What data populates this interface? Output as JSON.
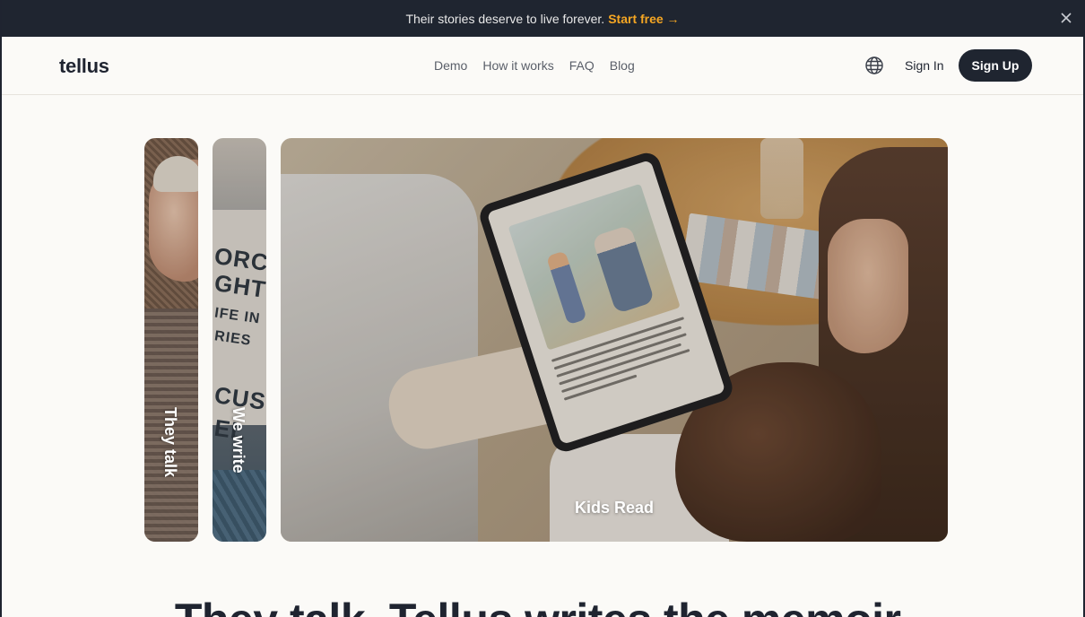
{
  "announcement": {
    "text": "Their stories deserve to live forever.",
    "cta": "Start free →"
  },
  "nav": {
    "logo": "tellus",
    "links": [
      "Demo",
      "How it works",
      "FAQ",
      "Blog"
    ],
    "sign_in": "Sign In",
    "sign_up": "Sign Up"
  },
  "cards": [
    {
      "label": "They talk"
    },
    {
      "label": "We write",
      "book_text": [
        "ORC",
        "GHT",
        "IFE IN",
        "RIES",
        "CUS",
        "EL"
      ]
    },
    {
      "label": "Kids Read"
    }
  ],
  "headline": "They talk. Tellus writes the memoir.",
  "colors": {
    "dark": "#1f2530",
    "accent": "#f5a623",
    "background": "#fbfaf7"
  }
}
